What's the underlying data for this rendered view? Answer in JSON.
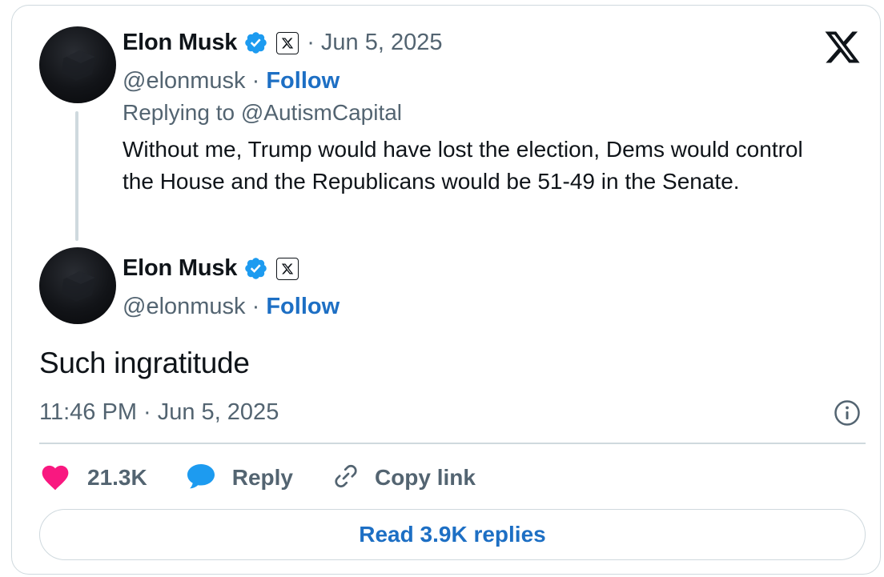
{
  "parent_tweet": {
    "author_name": "Elon Musk",
    "separator_date": "· Jun 5, 2025",
    "handle": "@elonmusk",
    "dot": " · ",
    "follow_label": "Follow",
    "replying_to": "Replying to @AutismCapital",
    "text": "Without me, Trump would have lost the election, Dems would control the House and the Republicans would be 51-49 in the Senate."
  },
  "reply_tweet": {
    "author_name": "Elon Musk",
    "handle": "@elonmusk",
    "dot": " · ",
    "follow_label": "Follow",
    "text": "Such ingratitude",
    "timestamp": "11:46 PM · Jun 5, 2025"
  },
  "actions": {
    "like_count": "21.3K",
    "reply_label": "Reply",
    "copy_link_label": "Copy link"
  },
  "read_replies_label": "Read 3.9K replies",
  "icons": {
    "verified": "verified-badge-icon",
    "affiliation": "x-affiliation-icon",
    "brand": "x-logo-icon",
    "info": "info-icon",
    "like": "heart-icon",
    "reply": "speech-bubble-icon",
    "copy": "link-icon"
  },
  "colors": {
    "link_blue": "#1d6fc4",
    "verified_blue": "#1d9bf0",
    "heart_pink": "#f91880",
    "reply_blue": "#1d9bf0",
    "muted_text": "#536471",
    "border": "#cfd9de"
  }
}
